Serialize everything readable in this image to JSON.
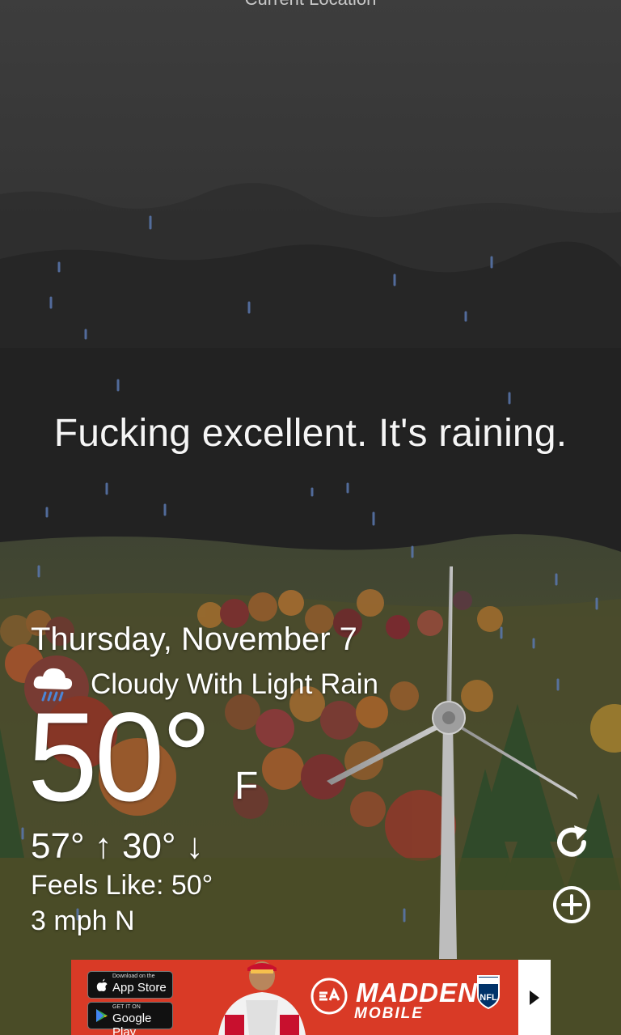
{
  "header": {
    "location_title": "Current Location"
  },
  "message": "Fucking excellent. It's raining.",
  "weather": {
    "date": "Thursday, November 7",
    "condition": "Cloudy With Light Rain",
    "condition_icon": "cloud-rain-icon",
    "temperature": "50°",
    "unit": "F",
    "high_low": "57° ↑  30° ↓",
    "feels_like": "Feels Like: 50°",
    "wind": "3 mph N"
  },
  "actions": {
    "refresh_icon": "refresh-icon",
    "add_icon": "add-location-icon"
  },
  "ad": {
    "app_store_small": "Download on the",
    "app_store_big": "App Store",
    "google_play_small": "GET IT ON",
    "google_play_big": "Google Play",
    "title": "MADDEN",
    "subtitle": "MOBILE",
    "nfl_text": "NFL",
    "colors": {
      "background": "#d93a26"
    }
  },
  "colors": {
    "sky": "#3a3a3a",
    "ground": "#4a4f30",
    "text": "#ffffff"
  }
}
